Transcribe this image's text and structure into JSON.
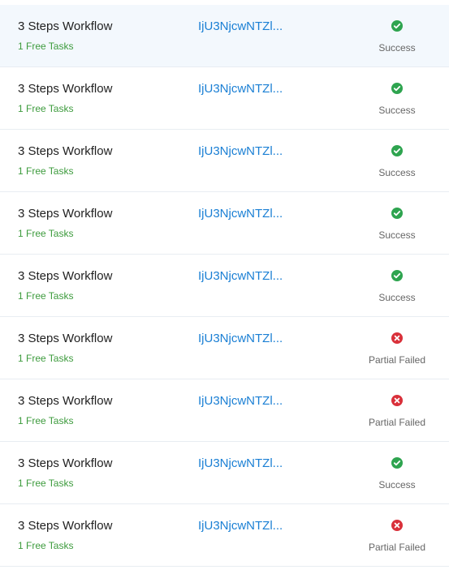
{
  "colors": {
    "success": "#2ea44f",
    "failed": "#d9303a",
    "link": "#1a7fd4",
    "tasks": "#3d9b3d",
    "row_highlight": "#f3f8fd"
  },
  "runs": [
    {
      "workflow": "3 Steps Workflow",
      "tasks": "1 Free Tasks",
      "id": "IjU3NjcwNTZl...",
      "status": "Success",
      "status_icon": "check-circle-icon"
    },
    {
      "workflow": "3 Steps Workflow",
      "tasks": "1 Free Tasks",
      "id": "IjU3NjcwNTZl...",
      "status": "Success",
      "status_icon": "check-circle-icon"
    },
    {
      "workflow": "3 Steps Workflow",
      "tasks": "1 Free Tasks",
      "id": "IjU3NjcwNTZl...",
      "status": "Success",
      "status_icon": "check-circle-icon"
    },
    {
      "workflow": "3 Steps Workflow",
      "tasks": "1 Free Tasks",
      "id": "IjU3NjcwNTZl...",
      "status": "Success",
      "status_icon": "check-circle-icon"
    },
    {
      "workflow": "3 Steps Workflow",
      "tasks": "1 Free Tasks",
      "id": "IjU3NjcwNTZl...",
      "status": "Success",
      "status_icon": "check-circle-icon"
    },
    {
      "workflow": "3 Steps Workflow",
      "tasks": "1 Free Tasks",
      "id": "IjU3NjcwNTZl...",
      "status": "Partial Failed",
      "status_icon": "x-circle-icon"
    },
    {
      "workflow": "3 Steps Workflow",
      "tasks": "1 Free Tasks",
      "id": "IjU3NjcwNTZl...",
      "status": "Partial Failed",
      "status_icon": "x-circle-icon"
    },
    {
      "workflow": "3 Steps Workflow",
      "tasks": "1 Free Tasks",
      "id": "IjU3NjcwNTZl...",
      "status": "Success",
      "status_icon": "check-circle-icon"
    },
    {
      "workflow": "3 Steps Workflow",
      "tasks": "1 Free Tasks",
      "id": "IjU3NjcwNTZl...",
      "status": "Partial Failed",
      "status_icon": "x-circle-icon"
    }
  ]
}
